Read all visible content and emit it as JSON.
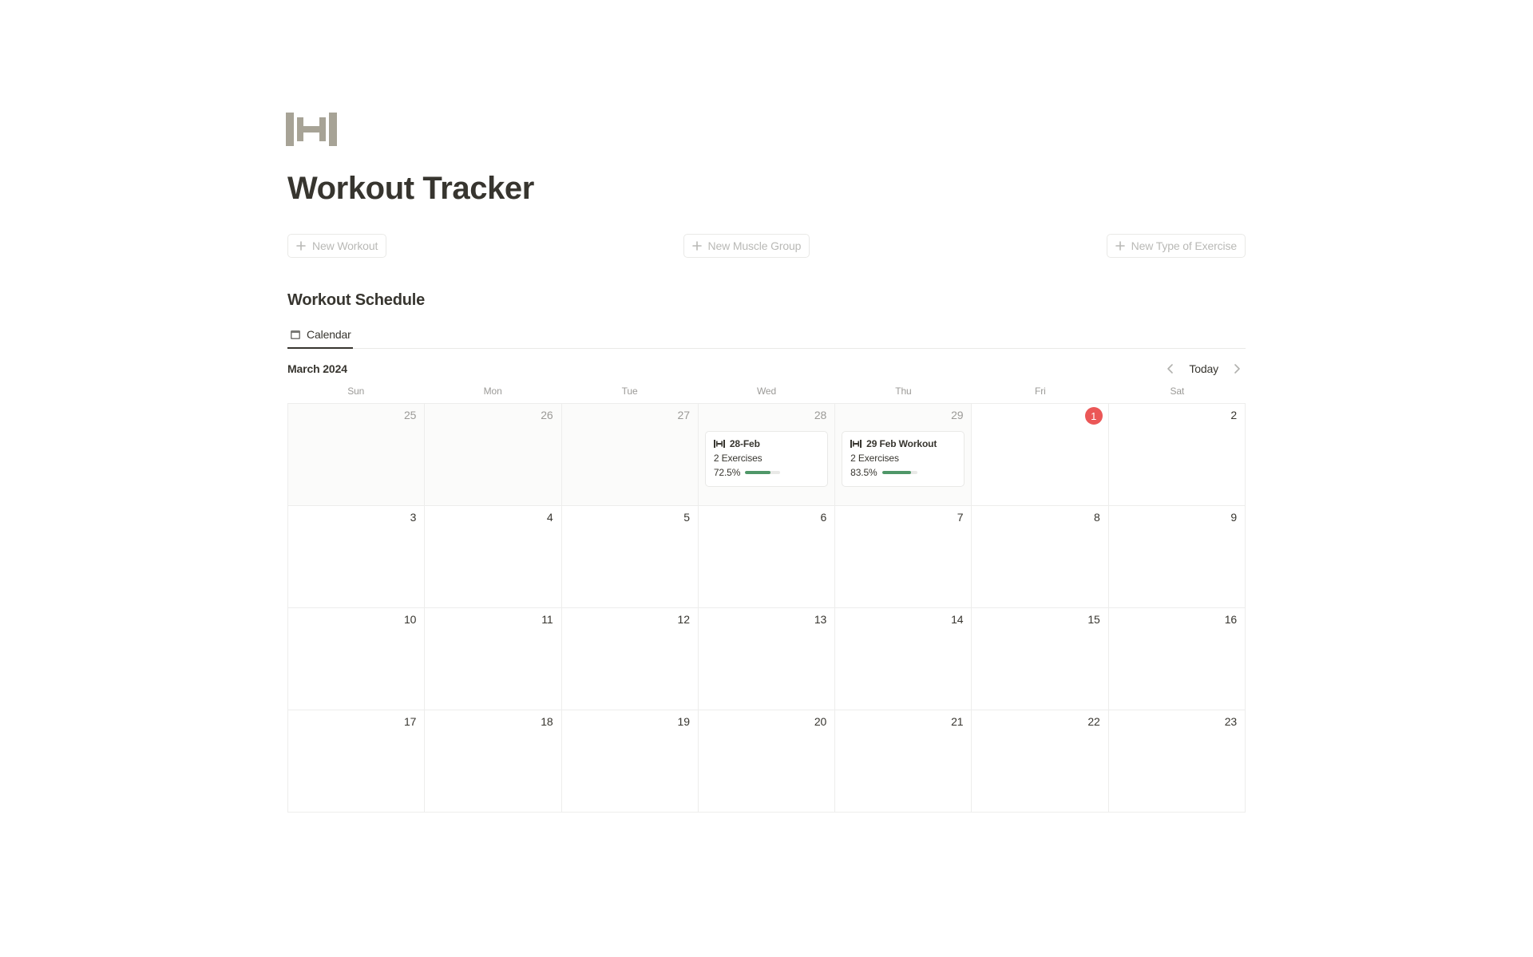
{
  "header": {
    "title": "Workout Tracker"
  },
  "buttons": {
    "new_workout": "New Workout",
    "new_muscle_group": "New Muscle Group",
    "new_exercise_type": "New Type of Exercise"
  },
  "section": {
    "title": "Workout Schedule"
  },
  "tabs": {
    "calendar": "Calendar"
  },
  "calendar": {
    "month_label": "March 2024",
    "today_label": "Today",
    "weekdays": [
      "Sun",
      "Mon",
      "Tue",
      "Wed",
      "Thu",
      "Fri",
      "Sat"
    ],
    "rows": [
      [
        {
          "day": "25",
          "other": true
        },
        {
          "day": "26",
          "other": true
        },
        {
          "day": "27",
          "other": true
        },
        {
          "day": "28",
          "other": true,
          "event": {
            "title": "28-Feb",
            "sub": "2 Exercises",
            "pct": "72.5%",
            "fill": 72.5
          }
        },
        {
          "day": "29",
          "other": true,
          "event": {
            "title": "29 Feb Workout",
            "sub": "2 Exercises",
            "pct": "83.5%",
            "fill": 83.5
          }
        },
        {
          "day": "1",
          "today": true
        },
        {
          "day": "2"
        }
      ],
      [
        {
          "day": "3"
        },
        {
          "day": "4"
        },
        {
          "day": "5"
        },
        {
          "day": "6"
        },
        {
          "day": "7"
        },
        {
          "day": "8"
        },
        {
          "day": "9"
        }
      ],
      [
        {
          "day": "10"
        },
        {
          "day": "11"
        },
        {
          "day": "12"
        },
        {
          "day": "13"
        },
        {
          "day": "14"
        },
        {
          "day": "15"
        },
        {
          "day": "16"
        }
      ],
      [
        {
          "day": "17"
        },
        {
          "day": "18"
        },
        {
          "day": "19"
        },
        {
          "day": "20"
        },
        {
          "day": "21"
        },
        {
          "day": "22"
        },
        {
          "day": "23"
        }
      ]
    ]
  }
}
